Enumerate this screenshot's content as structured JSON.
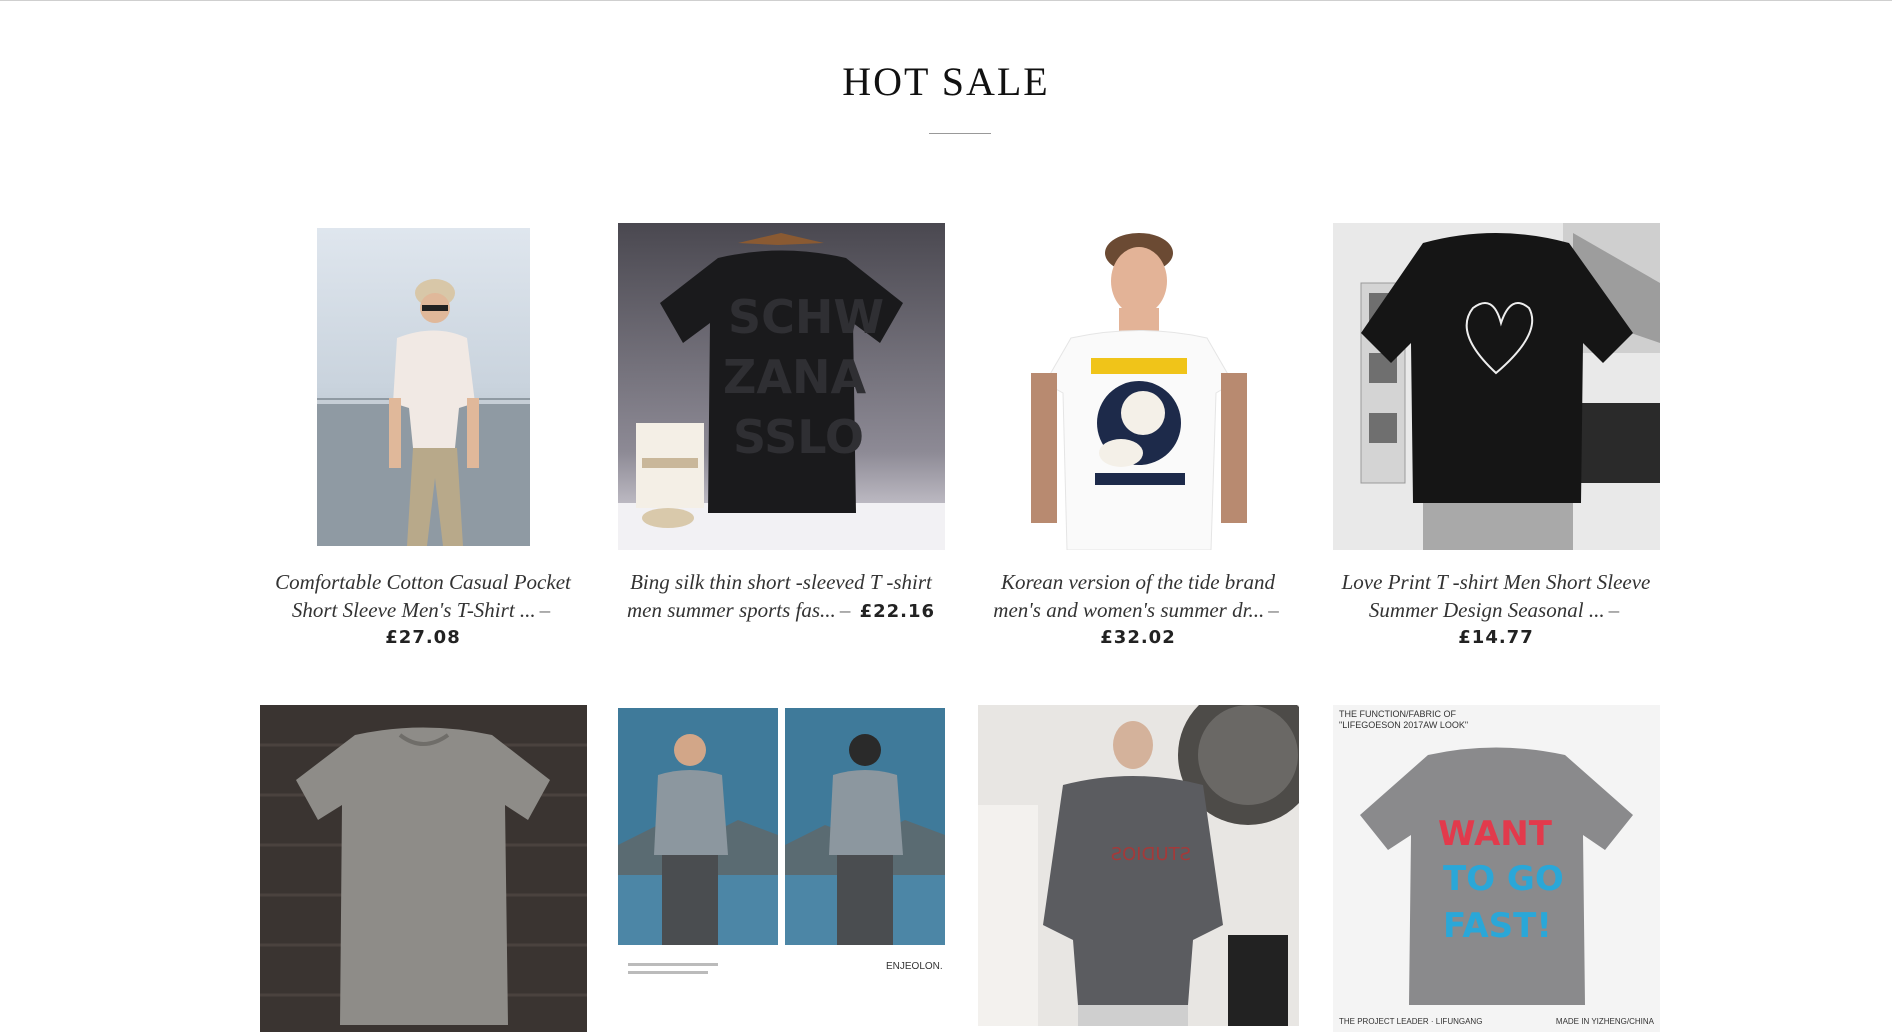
{
  "section": {
    "title": "HOT SALE"
  },
  "products": [
    {
      "name_line1": "Comfortable Cotton Casual Pocket",
      "name_line2": "Short Sleeve Men's T-Shirt ...",
      "price": "£27.08",
      "image_icon": "man-white-tshirt-photo"
    },
    {
      "name_line1": "Bing silk thin short -sleeved T -shirt",
      "name_line2": "men summer sports fas...",
      "price": "£22.16",
      "image_icon": "black-letter-tshirt-photo"
    },
    {
      "name_line1": "Korean version of the tide brand",
      "name_line2": "men's and women's summer dr...",
      "price": "£32.02",
      "image_icon": "popeye-print-tshirt-photo"
    },
    {
      "name_line1": "Love Print T -shirt Men Short Sleeve",
      "name_line2": "Summer Design Seasonal ...",
      "price": "£14.77",
      "image_icon": "heart-print-tshirt-photo"
    },
    {
      "image_icon": "grey-tshirt-wood-photo"
    },
    {
      "image_icon": "man-grey-tshirt-lake-photo",
      "caption_small": "ENJEOLON."
    },
    {
      "image_icon": "grey-longsleeve-photo"
    },
    {
      "image_icon": "graffiti-tshirt-photo",
      "header_line1": "THE FUNCTION/FABRIC OF",
      "header_line2": "\"LIFEGOESON 2017AW LOOK\"",
      "footer_left": "THE PROJECT LEADER · LIFUNGANG",
      "footer_right": "MADE IN YIZHENG/CHINA"
    }
  ],
  "colors": {
    "text": "#222222",
    "caption": "#333333",
    "divider": "#999999"
  }
}
